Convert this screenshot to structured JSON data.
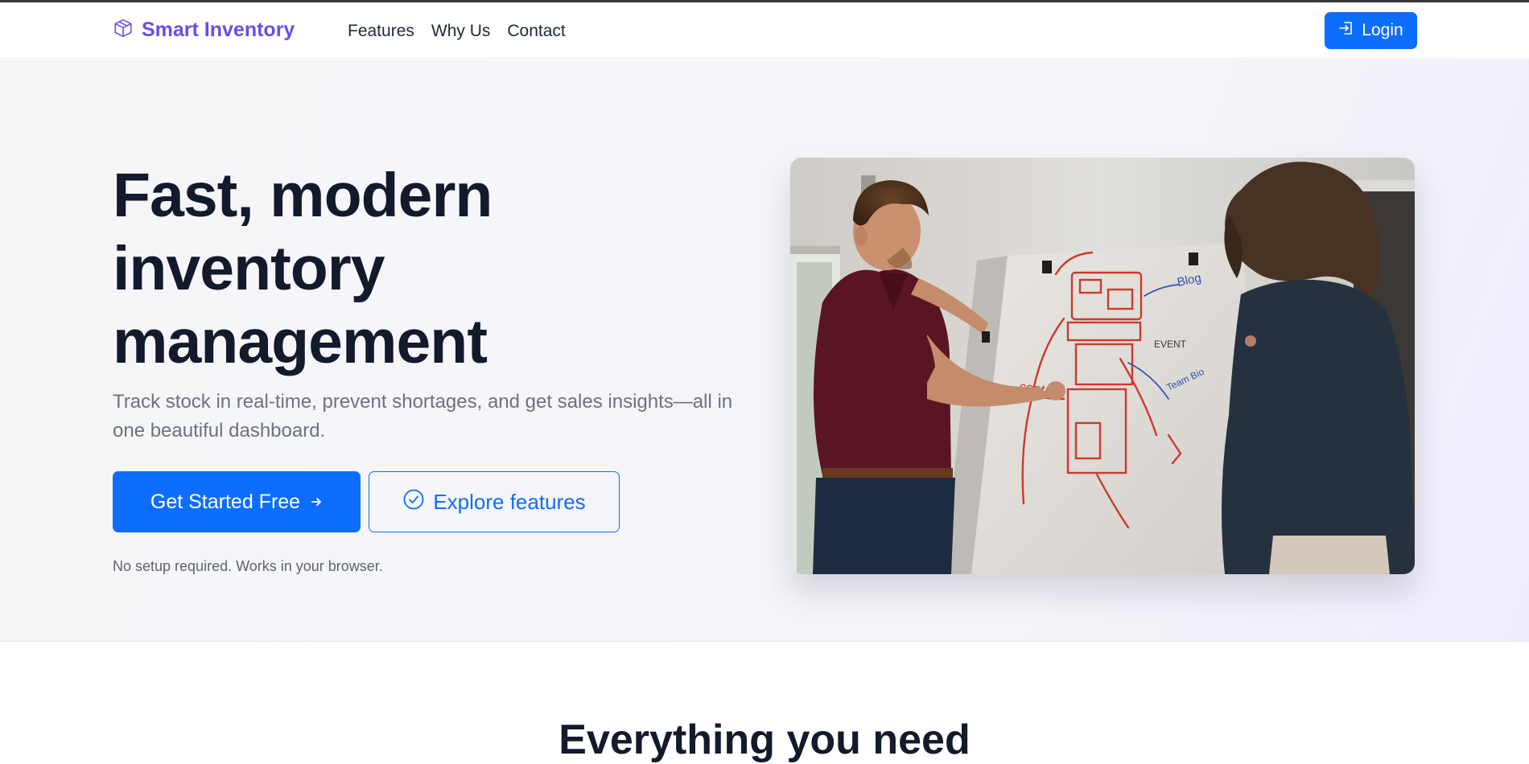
{
  "brand": {
    "name": "Smart Inventory",
    "icon": "box-icon",
    "color": "#6a4de8"
  },
  "nav": {
    "links": [
      {
        "label": "Features"
      },
      {
        "label": "Why Us"
      },
      {
        "label": "Contact"
      }
    ],
    "login": {
      "label": "Login",
      "icon": "login-icon"
    }
  },
  "hero": {
    "headline": [
      "Fast, modern",
      "inventory",
      "management"
    ],
    "subtext": "Track stock in real-time, prevent shortages, and get sales insights—all in one beautiful dashboard.",
    "primary_cta": {
      "label": "Get Started Free",
      "icon": "arrow-right-icon"
    },
    "secondary_cta": {
      "label": "Explore features",
      "icon": "check-circle-icon"
    },
    "note": "No setup required. Works in your browser.",
    "image": {
      "icon": "team-whiteboard-photo"
    }
  },
  "features": {
    "title": "Everything you need"
  },
  "colors": {
    "accent": "#0d6efd",
    "brand": "#6a4de8",
    "heading": "#121a2c",
    "muted": "#6b7280"
  }
}
